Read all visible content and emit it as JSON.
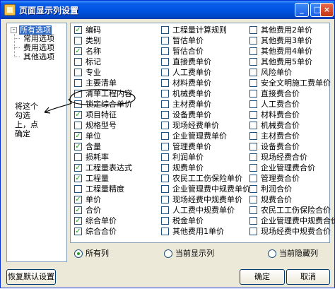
{
  "window": {
    "title": "页面显示列设置",
    "minimize": "_",
    "maximize": "□",
    "close": "×"
  },
  "tree": {
    "expander": "-",
    "root": "所有选项",
    "children": [
      "常用选项",
      "费用选项",
      "其他选项"
    ]
  },
  "annotation": {
    "text": "将这个勾选上，点确定"
  },
  "columns": {
    "col1": [
      {
        "label": "编码",
        "checked": true
      },
      {
        "label": "类别",
        "checked": false
      },
      {
        "label": "名称",
        "checked": true
      },
      {
        "label": "标记",
        "checked": false
      },
      {
        "label": "专业",
        "checked": false
      },
      {
        "label": "主要清单",
        "checked": false
      },
      {
        "label": "清单工程内容",
        "checked": false
      },
      {
        "label": "锁定综合单价",
        "checked": false
      },
      {
        "label": "项目特征",
        "checked": true
      },
      {
        "label": "规格型号",
        "checked": false
      },
      {
        "label": "单位",
        "checked": true
      },
      {
        "label": "含量",
        "checked": true
      },
      {
        "label": "损耗率",
        "checked": false
      },
      {
        "label": "工程量表达式",
        "checked": true
      },
      {
        "label": "工程量",
        "checked": true
      },
      {
        "label": "工程量精度",
        "checked": false
      },
      {
        "label": "单价",
        "checked": true
      },
      {
        "label": "合价",
        "checked": true
      },
      {
        "label": "综合单价",
        "checked": true
      },
      {
        "label": "综合合价",
        "checked": true
      }
    ],
    "col2": [
      {
        "label": "工程量计算规则",
        "checked": false
      },
      {
        "label": "暂估单价",
        "checked": false
      },
      {
        "label": "暂估合价",
        "checked": false
      },
      {
        "label": "直接费单价",
        "checked": false
      },
      {
        "label": "人工费单价",
        "checked": false
      },
      {
        "label": "材料费单价",
        "checked": false
      },
      {
        "label": "机械费单价",
        "checked": false
      },
      {
        "label": "主材费单价",
        "checked": false
      },
      {
        "label": "设备费单价",
        "checked": false
      },
      {
        "label": "现场经费单价",
        "checked": false
      },
      {
        "label": "企业管理费单价",
        "checked": false
      },
      {
        "label": "管理费单价",
        "checked": false
      },
      {
        "label": "利润单价",
        "checked": false
      },
      {
        "label": "规费单价",
        "checked": false
      },
      {
        "label": "农民工工伤保险单价",
        "checked": false
      },
      {
        "label": "企业管理费中规费单价",
        "checked": false
      },
      {
        "label": "现场经费中规费单价",
        "checked": false
      },
      {
        "label": "人工费中规费单价",
        "checked": false
      },
      {
        "label": "税金单价",
        "checked": false
      },
      {
        "label": "其他费用1单价",
        "checked": false
      }
    ],
    "col3": [
      {
        "label": "其他费用2单价",
        "checked": false
      },
      {
        "label": "其他费用3单价",
        "checked": false
      },
      {
        "label": "其他费用4单价",
        "checked": false
      },
      {
        "label": "其他费用5单价",
        "checked": false
      },
      {
        "label": "风险单价",
        "checked": false
      },
      {
        "label": "安全文明施工费单价",
        "checked": false
      },
      {
        "label": "直接费合价",
        "checked": false
      },
      {
        "label": "人工费合价",
        "checked": false
      },
      {
        "label": "材料费合价",
        "checked": false
      },
      {
        "label": "机械费合价",
        "checked": false
      },
      {
        "label": "主材费合价",
        "checked": false
      },
      {
        "label": "设备费合价",
        "checked": false
      },
      {
        "label": "现场经费合价",
        "checked": false
      },
      {
        "label": "企业管理费合价",
        "checked": false
      },
      {
        "label": "管理费合价",
        "checked": false
      },
      {
        "label": "利润合价",
        "checked": false
      },
      {
        "label": "规费合价",
        "checked": false
      },
      {
        "label": "农民工工伤保险合价",
        "checked": false
      },
      {
        "label": "企业管理费中规费合价",
        "checked": false
      },
      {
        "label": "现场经费中规费合价",
        "checked": false
      }
    ]
  },
  "filter": {
    "options": [
      "所有列",
      "当前显示列",
      "当前隐藏列"
    ],
    "selected": "所有列"
  },
  "buttons": {
    "restore": "恢复默认设置",
    "ok": "确定",
    "cancel": "取消"
  },
  "colors": {
    "titlebar": "#0054e3",
    "check": "#21a121",
    "selection": "#316ac5"
  }
}
